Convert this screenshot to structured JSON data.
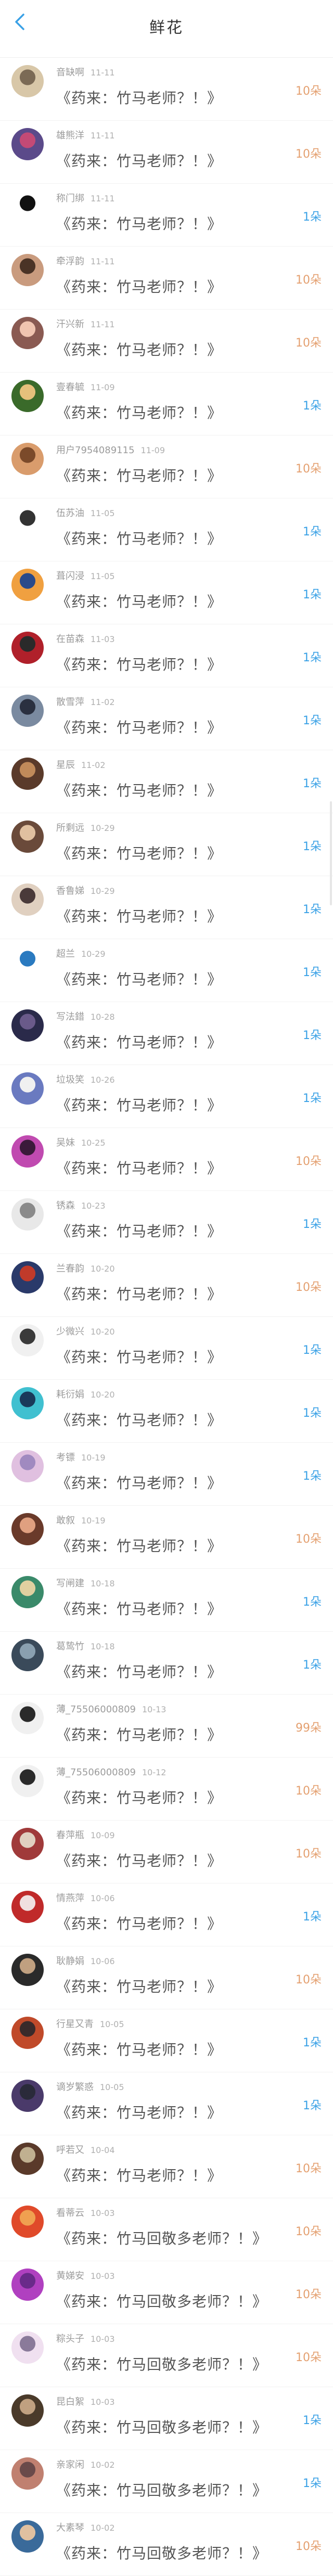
{
  "header": {
    "title": "鲜花"
  },
  "colors": {
    "gold": "#e4a070",
    "blue": "#3aa1e6",
    "back_icon": "#3aa1e6"
  },
  "rows": [
    {
      "name": "音缺啊",
      "time": "11-11",
      "message": "《药来：竹马老师？！》",
      "count": "10朵",
      "count_color": "gold",
      "avatar_colors": [
        "#d8c7a8",
        "#7b6a55"
      ]
    },
    {
      "name": "雄熊洋",
      "time": "11-11",
      "message": "《药来：竹马老师？！》",
      "count": "10朵",
      "count_color": "gold",
      "avatar_colors": [
        "#5b4a8a",
        "#c34a76"
      ]
    },
    {
      "name": "称门绑",
      "time": "11-11",
      "message": "《药来：竹马老师？！》",
      "count": "1朵",
      "count_color": "blue",
      "avatar_colors": [
        "#ffffff",
        "#111111"
      ]
    },
    {
      "name": "牵浮韵",
      "time": "11-11",
      "message": "《药来：竹马老师？！》",
      "count": "10朵",
      "count_color": "gold",
      "avatar_colors": [
        "#c99b7e",
        "#4a3326"
      ]
    },
    {
      "name": "汗兴新",
      "time": "11-11",
      "message": "《药来：竹马老师？！》",
      "count": "10朵",
      "count_color": "gold",
      "avatar_colors": [
        "#8a5a52",
        "#f0c4b0"
      ]
    },
    {
      "name": "壹春毓",
      "time": "11-09",
      "message": "《药来：竹马老师？！》",
      "count": "1朵",
      "count_color": "blue",
      "avatar_colors": [
        "#3a6a2a",
        "#e5c07b"
      ]
    },
    {
      "name": "用户7954089115",
      "time": "11-09",
      "message": "《药来：竹马老师？！》",
      "count": "10朵",
      "count_color": "gold",
      "avatar_colors": [
        "#d99c6c",
        "#7b4a2a"
      ]
    },
    {
      "name": "伍苏油",
      "time": "11-05",
      "message": "《药来：竹马老师？！》",
      "count": "1朵",
      "count_color": "blue",
      "avatar_colors": [
        "#ffffff",
        "#333333"
      ]
    },
    {
      "name": "葺闪浸",
      "time": "11-05",
      "message": "《药来：竹马老师？！》",
      "count": "1朵",
      "count_color": "blue",
      "avatar_colors": [
        "#f0a040",
        "#2a4a8a"
      ]
    },
    {
      "name": "在苗森",
      "time": "11-03",
      "message": "《药来：竹马老师？！》",
      "count": "1朵",
      "count_color": "blue",
      "avatar_colors": [
        "#b0202a",
        "#2a2a2a"
      ]
    },
    {
      "name": "散雪萍",
      "time": "11-02",
      "message": "《药来：竹马老师？！》",
      "count": "1朵",
      "count_color": "blue",
      "avatar_colors": [
        "#7a8aa0",
        "#2a3040"
      ]
    },
    {
      "name": "星辰",
      "time": "11-02",
      "message": "《药来：竹马老师？！》",
      "count": "1朵",
      "count_color": "blue",
      "avatar_colors": [
        "#5a3a2a",
        "#c08a5a"
      ]
    },
    {
      "name": "所剩远",
      "time": "10-29",
      "message": "《药来：竹马老师？！》",
      "count": "1朵",
      "count_color": "blue",
      "avatar_colors": [
        "#6a4a3a",
        "#e0c0a0"
      ]
    },
    {
      "name": "香鲁娣",
      "time": "10-29",
      "message": "《药来：竹马老师？！》",
      "count": "1朵",
      "count_color": "blue",
      "avatar_colors": [
        "#e0d0c0",
        "#4a3a3a"
      ]
    },
    {
      "name": "超兰",
      "time": "10-29",
      "message": "《药来：竹马老师？！》",
      "count": "1朵",
      "count_color": "blue",
      "avatar_colors": [
        "#ffffff",
        "#2a7ac0"
      ]
    },
    {
      "name": "写法錯",
      "time": "10-28",
      "message": "《药来：竹马老师？！》",
      "count": "1朵",
      "count_color": "blue",
      "avatar_colors": [
        "#2a2a4a",
        "#6a5a8a"
      ]
    },
    {
      "name": "垃圾笑",
      "time": "10-26",
      "message": "《药来：竹马老师？！》",
      "count": "1朵",
      "count_color": "blue",
      "avatar_colors": [
        "#6a7ac0",
        "#f0f0f0"
      ]
    },
    {
      "name": "吴妹",
      "time": "10-25",
      "message": "《药来：竹马老师？！》",
      "count": "10朵",
      "count_color": "gold",
      "avatar_colors": [
        "#c04ab0",
        "#3a1a3a"
      ]
    },
    {
      "name": "锈森",
      "time": "10-23",
      "message": "《药来：竹马老师？！》",
      "count": "1朵",
      "count_color": "blue",
      "avatar_colors": [
        "#e8e8e8",
        "#8a8a8a"
      ]
    },
    {
      "name": "兰春韵",
      "time": "10-20",
      "message": "《药来：竹马老师？！》",
      "count": "10朵",
      "count_color": "gold",
      "avatar_colors": [
        "#2a3a6a",
        "#c03a2a"
      ]
    },
    {
      "name": "少微兴",
      "time": "10-20",
      "message": "《药来：竹马老师？！》",
      "count": "1朵",
      "count_color": "blue",
      "avatar_colors": [
        "#f0f0f0",
        "#3a3a3a"
      ]
    },
    {
      "name": "耗衍娟",
      "time": "10-20",
      "message": "《药来：竹马老师？！》",
      "count": "1朵",
      "count_color": "blue",
      "avatar_colors": [
        "#40c0d0",
        "#1a3a5a"
      ]
    },
    {
      "name": "考镖",
      "time": "10-19",
      "message": "《药来：竹马老师？！》",
      "count": "1朵",
      "count_color": "blue",
      "avatar_colors": [
        "#e0c0e0",
        "#a08ac0"
      ]
    },
    {
      "name": "敢叙",
      "time": "10-19",
      "message": "《药来：竹马老师？！》",
      "count": "10朵",
      "count_color": "gold",
      "avatar_colors": [
        "#6a3a2a",
        "#e0a080"
      ]
    },
    {
      "name": "写闸建",
      "time": "10-18",
      "message": "《药来：竹马老师？！》",
      "count": "1朵",
      "count_color": "blue",
      "avatar_colors": [
        "#3a8a6a",
        "#e0d0a0"
      ]
    },
    {
      "name": "葛鸷竹",
      "time": "10-18",
      "message": "《药来：竹马老师？！》",
      "count": "1朵",
      "count_color": "blue",
      "avatar_colors": [
        "#3a4a5a",
        "#8aa0b0"
      ]
    },
    {
      "name": "薄_75506000809",
      "time": "10-13",
      "message": "《药来：竹马老师？！》",
      "count": "99朵",
      "count_color": "gold",
      "avatar_colors": [
        "#f0f0f0",
        "#2a2a2a"
      ]
    },
    {
      "name": "薄_75506000809",
      "time": "10-12",
      "message": "《药来：竹马老师？！》",
      "count": "10朵",
      "count_color": "gold",
      "avatar_colors": [
        "#f0f0f0",
        "#2a2a2a"
      ]
    },
    {
      "name": "春萍瓶",
      "time": "10-09",
      "message": "《药来：竹马老师？！》",
      "count": "10朵",
      "count_color": "gold",
      "avatar_colors": [
        "#a03a3a",
        "#e0d0c0"
      ]
    },
    {
      "name": "情燕萍",
      "time": "10-06",
      "message": "《药来：竹马老师？！》",
      "count": "1朵",
      "count_color": "blue",
      "avatar_colors": [
        "#c02a2a",
        "#f0e0e0"
      ]
    },
    {
      "name": "耿静娟",
      "time": "10-06",
      "message": "《药来：竹马老师？！》",
      "count": "10朵",
      "count_color": "gold",
      "avatar_colors": [
        "#2a2a2a",
        "#c0a080"
      ]
    },
    {
      "name": "行星又青",
      "time": "10-05",
      "message": "《药来：竹马老师？！》",
      "count": "1朵",
      "count_color": "blue",
      "avatar_colors": [
        "#c04a2a",
        "#3a2a2a"
      ]
    },
    {
      "name": "谪岁繁惑",
      "time": "10-05",
      "message": "《药来：竹马老师？！》",
      "count": "1朵",
      "count_color": "blue",
      "avatar_colors": [
        "#4a3a6a",
        "#2a2a3a"
      ]
    },
    {
      "name": "呼若又",
      "time": "10-04",
      "message": "《药来：竹马老师？！》",
      "count": "10朵",
      "count_color": "gold",
      "avatar_colors": [
        "#5a3a2a",
        "#c0b090"
      ]
    },
    {
      "name": "看蒂云",
      "time": "10-03",
      "message": "《药来：竹马回敬多老师？！》",
      "count": "10朵",
      "count_color": "gold",
      "avatar_colors": [
        "#e04a2a",
        "#f0a050"
      ]
    },
    {
      "name": "黄娣安",
      "time": "10-03",
      "message": "《药来：竹马回敬多老师？！》",
      "count": "10朵",
      "count_color": "gold",
      "avatar_colors": [
        "#b040c0",
        "#6a2a8a"
      ]
    },
    {
      "name": "粽头子",
      "time": "10-03",
      "message": "《药来：竹马回敬多老师？！》",
      "count": "10朵",
      "count_color": "gold",
      "avatar_colors": [
        "#f0e0f0",
        "#8a7a9a"
      ]
    },
    {
      "name": "昆白絮",
      "time": "10-03",
      "message": "《药来：竹马回敬多老师？！》",
      "count": "1朵",
      "count_color": "blue",
      "avatar_colors": [
        "#4a3a2a",
        "#c0a080"
      ]
    },
    {
      "name": "亲家闲",
      "time": "10-02",
      "message": "《药来：竹马回敬多老师？！》",
      "count": "1朵",
      "count_color": "blue",
      "avatar_colors": [
        "#c08070",
        "#6a4a4a"
      ]
    },
    {
      "name": "大素琴",
      "time": "10-02",
      "message": "《药来：竹马回敬多老师？！》",
      "count": "10朵",
      "count_color": "gold",
      "avatar_colors": [
        "#3a6a9a",
        "#e0c0a0"
      ]
    }
  ]
}
